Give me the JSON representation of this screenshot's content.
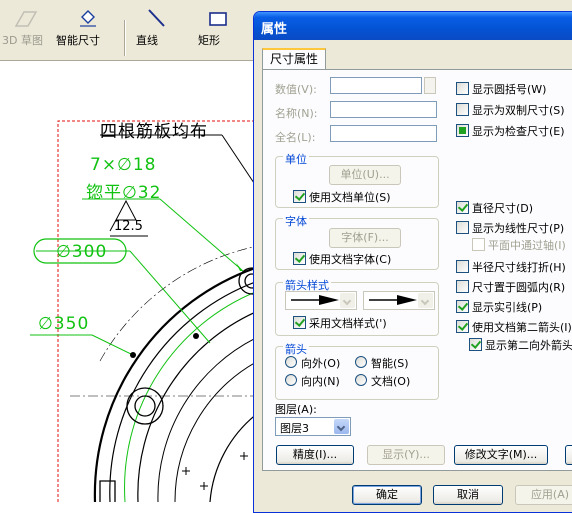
{
  "toolbar": {
    "items": [
      {
        "label": "3D 草图",
        "icon": "3d-sketch-icon",
        "disabled": true
      },
      {
        "label": "智能尺寸",
        "icon": "smart-dimension-icon",
        "disabled": false
      },
      {
        "label": "直线",
        "icon": "line-icon",
        "disabled": false
      },
      {
        "label": "矩形",
        "icon": "rectangle-icon",
        "disabled": false
      }
    ]
  },
  "drawing": {
    "note_title": "四根筋板均布",
    "annotations": [
      {
        "text": "7×∅18",
        "color": "#11c211"
      },
      {
        "text": "锪平∅32",
        "color": "#11c211"
      },
      {
        "text": "12.5",
        "color": "#000000"
      },
      {
        "text": "∅300",
        "color": "#11c211"
      },
      {
        "text": "∅350",
        "color": "#11c211"
      }
    ]
  },
  "dialog": {
    "title": "属性",
    "tab": "尺寸属性",
    "fields": {
      "value_label": "数值(V):",
      "name_label": "名称(N):",
      "fullname_label": "全名(L):"
    },
    "unit_group": {
      "title": "单位",
      "unit_button": "单位(U)...",
      "use_doc_units": "使用文档单位(S)"
    },
    "font_group": {
      "title": "字体",
      "font_button": "字体(F)...",
      "use_doc_font": "使用文档字体(C)"
    },
    "arrow_style_group": {
      "title": "箭头样式",
      "use_doc_style": "采用文档样式(')"
    },
    "arrow_group": {
      "title": "箭头",
      "outside": "向外(O)",
      "smart": "智能(S)",
      "inside": "向内(N)",
      "document": "文档(O)"
    },
    "right_options": [
      {
        "label": "显示圆括号(W)",
        "state": "off",
        "indent": false
      },
      {
        "label": "显示为双制尺寸(S)",
        "state": "off",
        "indent": false
      },
      {
        "label": "显示为检查尺寸(E)",
        "state": "partial",
        "indent": false
      },
      {
        "label": "直径尺寸(D)",
        "state": "on",
        "indent": false
      },
      {
        "label": "显示为线性尺寸(P)",
        "state": "off",
        "indent": false
      },
      {
        "label": "平面中通过轴(I)",
        "state": "disabled",
        "indent": true
      },
      {
        "label": "半径尺寸线打折(H)",
        "state": "off",
        "indent": false
      },
      {
        "label": "尺寸置于圆弧内(R)",
        "state": "off",
        "indent": false
      },
      {
        "label": "显示实引线(P)",
        "state": "on",
        "indent": false
      },
      {
        "label": "使用文档第二箭头(I)",
        "state": "on",
        "indent": false
      },
      {
        "label": "显示第二向外箭头",
        "state": "on",
        "indent": true
      }
    ],
    "layer": {
      "label": "图层(A):",
      "value": "图层3"
    },
    "buttons": {
      "precision": "精度(I)...",
      "display": "显示(Y)...",
      "modify_text": "修改文字(M)...",
      "ok": "确定",
      "cancel": "取消",
      "apply": "应用(A)"
    }
  }
}
